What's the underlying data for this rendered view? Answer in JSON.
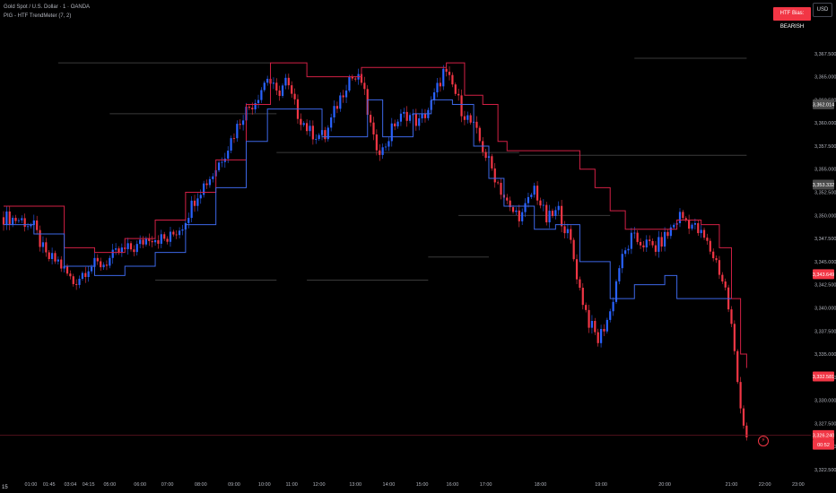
{
  "header": {
    "symbol_line": "Gold Spot / U.S. Dollar · 1 · OANDA",
    "indicator_line": "PIG - HTF TrendMeter (7, 2)"
  },
  "bias_badge": {
    "label": "HTF Bias: BEARISH",
    "color": "#f23645"
  },
  "currency_button": "USD",
  "interval_label": "15",
  "colors": {
    "background": "#000000",
    "bull_candle": "#2962ff",
    "bear_candle": "#f23645",
    "upper_line": "#d22045",
    "lower_line": "#3d67e6",
    "htf_line": "#3a3a3a",
    "axis_text": "#b2b5be"
  },
  "chart_data": {
    "type": "candlestick",
    "ylim": [
      3322.5,
      3370.0
    ],
    "y_ticks": [
      "3,367.500",
      "3,365.000",
      "3,362.500",
      "3,360.000",
      "3,357.500",
      "3,355.000",
      "3,352.500",
      "3,350.000",
      "3,347.500",
      "3,345.000",
      "3,342.500",
      "3,340.000",
      "3,337.500",
      "3,335.000",
      "3,332.500",
      "3,330.000",
      "3,327.500",
      "3,325.000",
      "3,322.500"
    ],
    "y_tick_values": [
      3367.5,
      3365.0,
      3362.5,
      3360.0,
      3357.5,
      3355.0,
      3352.5,
      3350.0,
      3347.5,
      3345.0,
      3342.5,
      3340.0,
      3337.5,
      3335.0,
      3332.5,
      3330.0,
      3327.5,
      3325.0,
      3322.5
    ],
    "x_tick_labels": [
      "01:00",
      "01:45",
      "03:04",
      "04:15",
      "05:00",
      "06:00",
      "07:00",
      "08:00",
      "09:00",
      "10:00",
      "11:00",
      "12:00",
      "13:00",
      "14:00",
      "15:00",
      "16:00",
      "17:00",
      "18:00",
      "19:00",
      "20:00",
      "21:00",
      "22:00",
      "23:00"
    ],
    "x_tick_index": [
      9,
      15,
      22,
      28,
      35,
      45,
      54,
      65,
      76,
      86,
      95,
      104,
      116,
      127,
      138,
      148,
      159,
      177,
      197,
      218,
      240,
      251,
      262
    ],
    "x_index_range": [
      0,
      265
    ],
    "price_labels": [
      {
        "text": "3,362.014",
        "value": 3362.014,
        "bg": "#4a4a4a",
        "fg": "#ffffff"
      },
      {
        "text": "3,353.332",
        "value": 3353.332,
        "bg": "#4a4a4a",
        "fg": "#ffffff"
      },
      {
        "text": "3,343.649",
        "value": 3343.649,
        "bg": "#f23645",
        "fg": "#ffffff"
      },
      {
        "text": "3,332.581",
        "value": 3332.581,
        "bg": "#f23645",
        "fg": "#ffffff"
      },
      {
        "text": "3,326.240",
        "value": 3326.24,
        "bg": "#f23645",
        "fg": "#ffffff"
      },
      {
        "text": "00:52",
        "value": 3325.2,
        "bg": "#f23645",
        "fg": "#ffffff"
      }
    ],
    "close_path": [
      [
        0,
        3349.8
      ],
      [
        6,
        3349.5
      ],
      [
        10,
        3348.7
      ],
      [
        14,
        3345.5
      ],
      [
        18,
        3345.0
      ],
      [
        23,
        3342.7
      ],
      [
        28,
        3344.5
      ],
      [
        33,
        3344.8
      ],
      [
        38,
        3346.0
      ],
      [
        44,
        3346.6
      ],
      [
        48,
        3347.8
      ],
      [
        54,
        3347.3
      ],
      [
        59,
        3349.0
      ],
      [
        64,
        3352.5
      ],
      [
        69,
        3354.5
      ],
      [
        74,
        3357.5
      ],
      [
        79,
        3361.0
      ],
      [
        83,
        3362.5
      ],
      [
        87,
        3365.0
      ],
      [
        90,
        3363.0
      ],
      [
        93,
        3364.5
      ],
      [
        97,
        3361.0
      ],
      [
        101,
        3359.0
      ],
      [
        106,
        3358.5
      ],
      [
        110,
        3362.0
      ],
      [
        114,
        3365.0
      ],
      [
        118,
        3364.5
      ],
      [
        122,
        3358.0
      ],
      [
        125,
        3357.0
      ],
      [
        129,
        3360.0
      ],
      [
        133,
        3361.0
      ],
      [
        137,
        3360.0
      ],
      [
        141,
        3362.0
      ],
      [
        145,
        3365.5
      ],
      [
        148,
        3364.0
      ],
      [
        151,
        3361.5
      ],
      [
        155,
        3359.5
      ],
      [
        159,
        3356.5
      ],
      [
        163,
        3353.5
      ],
      [
        167,
        3350.5
      ],
      [
        171,
        3350.0
      ],
      [
        175,
        3353.0
      ],
      [
        179,
        3349.5
      ],
      [
        183,
        3350.5
      ],
      [
        187,
        3347.0
      ],
      [
        190,
        3342.0
      ],
      [
        193,
        3338.5
      ],
      [
        196,
        3336.5
      ],
      [
        200,
        3339.5
      ],
      [
        203,
        3344.5
      ],
      [
        207,
        3347.5
      ],
      [
        211,
        3347.0
      ],
      [
        215,
        3346.5
      ],
      [
        219,
        3348.0
      ],
      [
        223,
        3350.0
      ],
      [
        227,
        3349.0
      ],
      [
        231,
        3347.5
      ],
      [
        235,
        3345.0
      ],
      [
        238,
        3342.0
      ],
      [
        240,
        3338.0
      ],
      [
        242,
        3332.0
      ],
      [
        244,
        3327.5
      ],
      [
        245,
        3326.24
      ]
    ],
    "upper_line": [
      [
        0,
        3351.0
      ],
      [
        15,
        3351.0
      ],
      [
        20,
        3346.5
      ],
      [
        30,
        3346.0
      ],
      [
        40,
        3347.5
      ],
      [
        50,
        3349.5
      ],
      [
        60,
        3352.5
      ],
      [
        70,
        3356.0
      ],
      [
        80,
        3362.0
      ],
      [
        88,
        3366.5
      ],
      [
        100,
        3365.0
      ],
      [
        110,
        3365.0
      ],
      [
        118,
        3366.0
      ],
      [
        128,
        3366.0
      ],
      [
        140,
        3366.0
      ],
      [
        146,
        3366.5
      ],
      [
        152,
        3363.0
      ],
      [
        158,
        3362.0
      ],
      [
        163,
        3358.0
      ],
      [
        166,
        3357.0
      ],
      [
        175,
        3357.0
      ],
      [
        185,
        3357.0
      ],
      [
        190,
        3355.0
      ],
      [
        195,
        3353.0
      ],
      [
        200,
        3350.5
      ],
      [
        205,
        3348.5
      ],
      [
        210,
        3348.5
      ],
      [
        218,
        3348.5
      ],
      [
        222,
        3349.5
      ],
      [
        230,
        3349.0
      ],
      [
        236,
        3346.5
      ],
      [
        240,
        3341.0
      ],
      [
        243,
        3335.0
      ],
      [
        245,
        3333.5
      ]
    ],
    "lower_line": [
      [
        0,
        3349.0
      ],
      [
        10,
        3348.0
      ],
      [
        20,
        3344.5
      ],
      [
        30,
        3343.5
      ],
      [
        40,
        3344.5
      ],
      [
        50,
        3346.0
      ],
      [
        55,
        3346.0
      ],
      [
        60,
        3349.0
      ],
      [
        70,
        3353.0
      ],
      [
        80,
        3358.0
      ],
      [
        87,
        3361.5
      ],
      [
        95,
        3361.5
      ],
      [
        105,
        3358.5
      ],
      [
        110,
        3358.5
      ],
      [
        120,
        3362.5
      ],
      [
        125,
        3358.5
      ],
      [
        135,
        3361.0
      ],
      [
        141,
        3362.5
      ],
      [
        148,
        3362.0
      ],
      [
        155,
        3357.5
      ],
      [
        160,
        3354.0
      ],
      [
        165,
        3351.0
      ],
      [
        175,
        3348.5
      ],
      [
        182,
        3349.0
      ],
      [
        190,
        3345.0
      ],
      [
        200,
        3341.0
      ],
      [
        208,
        3342.5
      ],
      [
        218,
        3343.5
      ],
      [
        222,
        3341.0
      ],
      [
        230,
        3341.0
      ],
      [
        236,
        3341.0
      ],
      [
        240,
        3341.0
      ]
    ],
    "htf_segments": [
      {
        "y": 3366.5,
        "x0": 18,
        "x1": 88
      },
      {
        "y": 3361.0,
        "x0": 35,
        "x1": 90
      },
      {
        "y": 3356.8,
        "x0": 90,
        "x1": 170
      },
      {
        "y": 3356.5,
        "x0": 170,
        "x1": 245
      },
      {
        "y": 3343.0,
        "x0": 50,
        "x1": 90
      },
      {
        "y": 3345.5,
        "x0": 140,
        "x1": 160
      },
      {
        "y": 3343.0,
        "x0": 100,
        "x1": 140
      },
      {
        "y": 3350.0,
        "x0": 150,
        "x1": 200
      },
      {
        "y": 3367.0,
        "x0": 208,
        "x1": 245
      }
    ]
  }
}
